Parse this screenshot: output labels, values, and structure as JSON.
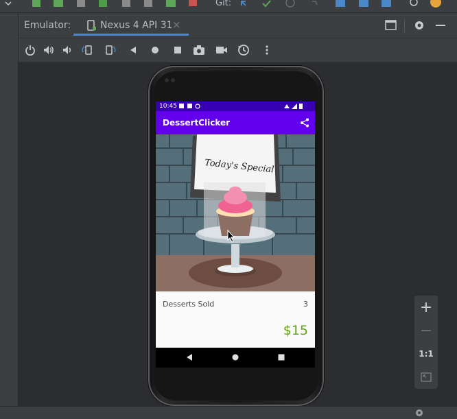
{
  "ide": {
    "git_label": "Git:",
    "emulator_label": "Emulator:",
    "device_tab": "Nexus 4 API 31",
    "close_glyph": "×"
  },
  "toolbar_icons": [
    "power-icon",
    "volume-up-icon",
    "volume-down-icon",
    "rotate-left-icon",
    "rotate-right-icon",
    "back-icon",
    "home-icon",
    "overview-icon",
    "screenshot-icon",
    "screen-record-icon",
    "snapshot-icon",
    "more-icon"
  ],
  "phone": {
    "status_time": "10:45",
    "app_title": "DessertClicker",
    "sign_text": "Today's Special",
    "desserts_label": "Desserts Sold",
    "desserts_count": "3",
    "revenue": "$15"
  },
  "zoom": {
    "plus": "+",
    "minus": "−",
    "one_to_one": "1:1"
  },
  "colors": {
    "ide_bg": "#2b2d30",
    "panel": "#3c3f41",
    "accent": "#4a88c7",
    "app_primary": "#6200ee",
    "app_primary_dark": "#3700b3",
    "revenue_green": "#64a515"
  }
}
